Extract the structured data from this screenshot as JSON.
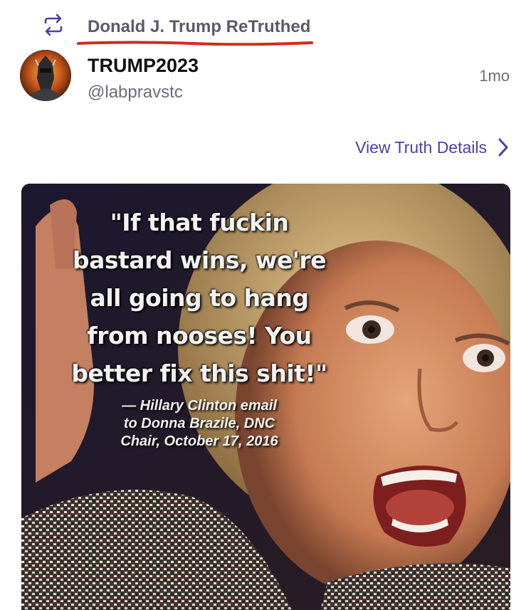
{
  "retruth": {
    "label": "Donald J. Trump ReTruthed",
    "icon": "repost-icon"
  },
  "post": {
    "display_name": "TRUMP2023",
    "handle": "@labpravstc",
    "timestamp": "1mo",
    "avatar": "avatar"
  },
  "details_link": {
    "label": "View Truth Details",
    "icon": "chevron-right-icon"
  },
  "media": {
    "quote": "\"If that fuckin\nbastard wins, we're\nall going to hang\nfrom nooses! You\nbetter fix this shit!\"",
    "attribution": "— Hillary Clinton email\nto Donna Brazile, DNC\nChair, October 17, 2016"
  },
  "colors": {
    "accent": "#4c3fa8",
    "underline": "#d62a1e",
    "muted": "#6c6c7c"
  }
}
